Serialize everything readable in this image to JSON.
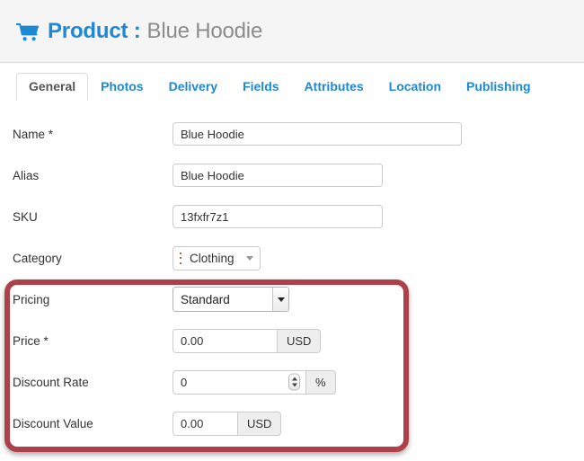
{
  "header": {
    "icon": "shopping-cart-icon",
    "title_primary": "Product :",
    "title_secondary": "Blue Hoodie",
    "accent_color": "#1e88d3",
    "muted_color": "#8c8c8c",
    "background": "#f5f5f5"
  },
  "tabs": {
    "active_index": 0,
    "items": [
      {
        "label": "General"
      },
      {
        "label": "Photos"
      },
      {
        "label": "Delivery"
      },
      {
        "label": "Fields"
      },
      {
        "label": "Attributes"
      },
      {
        "label": "Location"
      },
      {
        "label": "Publishing"
      }
    ]
  },
  "form": {
    "name": {
      "label": "Name *",
      "value": "Blue Hoodie",
      "placeholder": ""
    },
    "alias": {
      "label": "Alias",
      "value": "Blue Hoodie",
      "placeholder": ""
    },
    "sku": {
      "label": "SKU",
      "value": "13fxfr7z1",
      "placeholder": ""
    },
    "category": {
      "label": "Category",
      "value": "Clothing",
      "handle_icon": "drag-handle-icon",
      "caret_icon": "chevron-down-icon"
    },
    "pricing": {
      "label": "Pricing",
      "value": "Standard",
      "options": [
        "Standard"
      ],
      "caret_icon": "select-arrow-icon"
    },
    "price": {
      "label": "Price *",
      "value": "0.00",
      "addon": "USD",
      "placeholder": ""
    },
    "discount_rate": {
      "label": "Discount Rate",
      "value": "0",
      "addon": "%",
      "spinner_icon": "number-spinner-icon",
      "placeholder": ""
    },
    "discount_value": {
      "label": "Discount Value",
      "value": "0.00",
      "addon": "USD",
      "placeholder": ""
    }
  },
  "highlight": {
    "name": "pricing-section-highlight",
    "color": "#ad4049"
  }
}
